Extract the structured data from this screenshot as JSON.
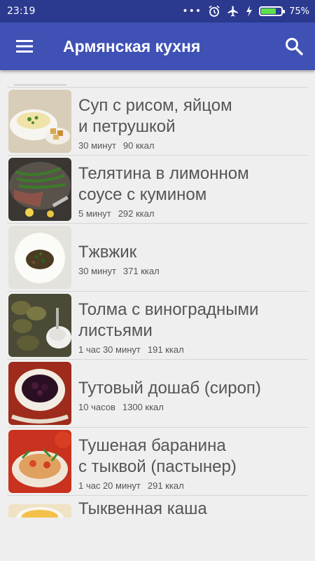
{
  "status_bar": {
    "time": "23:19",
    "battery_percent": "75%",
    "battery_level": 0.75,
    "icons": [
      "dots-icon",
      "alarm-icon",
      "airplane-icon",
      "charging-icon",
      "battery-icon"
    ]
  },
  "app_bar": {
    "title": "Армянская кухня",
    "menu_icon": "hamburger-menu-icon",
    "search_icon": "search-icon"
  },
  "recipes": [
    {
      "title_line1": "Суп с рисом, яйцом",
      "title_line2": "и петрушкой",
      "time": "30 минут",
      "kcal": "90 ккал"
    },
    {
      "title_line1": "Телятина в лимонном",
      "title_line2": "соусе с кумином",
      "time": "5 минут",
      "kcal": "292 ккал"
    },
    {
      "title_line1": "Тжвжик",
      "title_line2": "",
      "time": "30 минут",
      "kcal": "371 ккал"
    },
    {
      "title_line1": "Толма с виноградными",
      "title_line2": "листьями",
      "time": "1 час 30 минут",
      "kcal": "191 ккал"
    },
    {
      "title_line1": "Тутовый дошаб (сироп)",
      "title_line2": "",
      "time": "10 часов",
      "kcal": "1300 ккал"
    },
    {
      "title_line1": "Тушеная баранина",
      "title_line2": "с тыквой (пастынер)",
      "time": "1 час 20 минут",
      "kcal": "291 ккал"
    },
    {
      "title_line1": "Тыквенная каша",
      "title_line2": "",
      "time": "",
      "kcal": ""
    }
  ],
  "colors": {
    "status_bar": "#2b3a8f",
    "app_bar": "#3f51b5",
    "background": "#efefef",
    "text": "#555555"
  }
}
